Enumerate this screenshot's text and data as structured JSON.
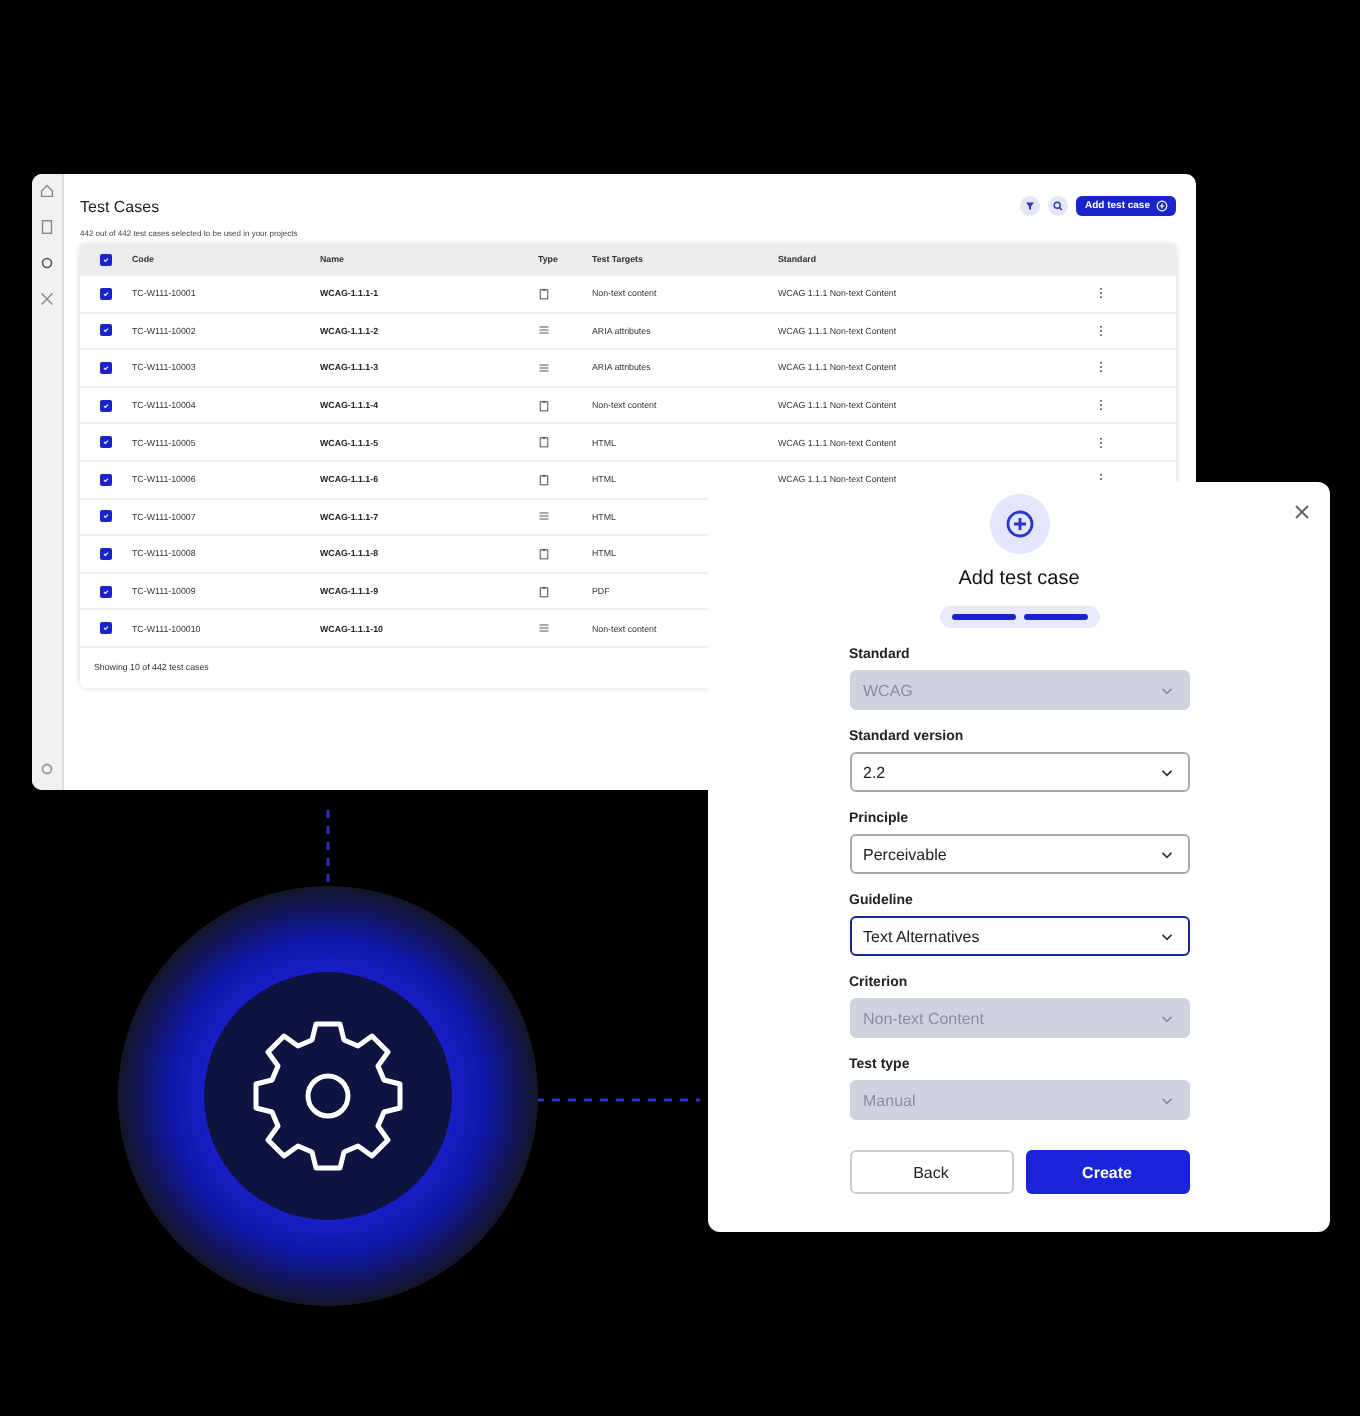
{
  "table_window": {
    "title": "Test Cases",
    "subtitle": "442 out of 442 test cases selected to be used in your projects",
    "add_button": "Add test case",
    "columns": [
      "Code",
      "Name",
      "Type",
      "Test Targets",
      "Standard"
    ],
    "all_checked": true,
    "rows": [
      {
        "checked": true,
        "code": "TC-W111-10001",
        "name": "WCAG-1.1.1-1",
        "kind": "doc",
        "target": "Non-text content",
        "standard": "WCAG 1.1.1 Non-text Content"
      },
      {
        "checked": true,
        "code": "TC-W111-10002",
        "name": "WCAG-1.1.1-2",
        "kind": "list",
        "target": "ARIA attributes",
        "standard": "WCAG 1.1.1 Non-text Content"
      },
      {
        "checked": true,
        "code": "TC-W111-10003",
        "name": "WCAG-1.1.1-3",
        "kind": "list",
        "target": "ARIA attributes",
        "standard": "WCAG 1.1.1 Non-text Content"
      },
      {
        "checked": true,
        "code": "TC-W111-10004",
        "name": "WCAG-1.1.1-4",
        "kind": "doc",
        "target": "Non-text content",
        "standard": "WCAG 1.1.1 Non-text Content"
      },
      {
        "checked": true,
        "code": "TC-W111-10005",
        "name": "WCAG-1.1.1-5",
        "kind": "doc",
        "target": "HTML",
        "standard": "WCAG 1.1.1 Non-text Content"
      },
      {
        "checked": true,
        "code": "TC-W111-10006",
        "name": "WCAG-1.1.1-6",
        "kind": "doc",
        "target": "HTML",
        "standard": "WCAG 1.1.1 Non-text Content"
      },
      {
        "checked": true,
        "code": "TC-W111-10007",
        "name": "WCAG-1.1.1-7",
        "kind": "list",
        "target": "HTML"
      },
      {
        "checked": true,
        "code": "TC-W111-10008",
        "name": "WCAG-1.1.1-8",
        "kind": "doc",
        "target": "HTML"
      },
      {
        "checked": true,
        "code": "TC-W111-10009",
        "name": "WCAG-1.1.1-9",
        "kind": "doc",
        "target": "PDF"
      },
      {
        "checked": true,
        "code": "TC-W111-100010",
        "name": "WCAG-1.1.1-10",
        "kind": "list",
        "target": "Non-text content"
      }
    ],
    "footer": "Showing 10 of 442 test cases"
  },
  "modal": {
    "title": "Add test case",
    "steps": [
      {
        "done": true
      },
      {
        "done": true
      }
    ],
    "fields": [
      {
        "label": "Standard",
        "value": "WCAG",
        "disabled": true,
        "focused": false
      },
      {
        "label": "Standard version",
        "value": "2.2",
        "disabled": false,
        "focused": false
      },
      {
        "label": "Principle",
        "value": "Perceivable",
        "disabled": false,
        "focused": false
      },
      {
        "label": "Guideline",
        "value": "Text Alternatives",
        "disabled": false,
        "focused": true
      },
      {
        "label": "Criterion",
        "value": "Non-text Content",
        "disabled": true,
        "focused": false
      },
      {
        "label": "Test type",
        "value": "Manual",
        "disabled": true,
        "focused": false
      }
    ],
    "back": "Back",
    "create": "Create"
  }
}
